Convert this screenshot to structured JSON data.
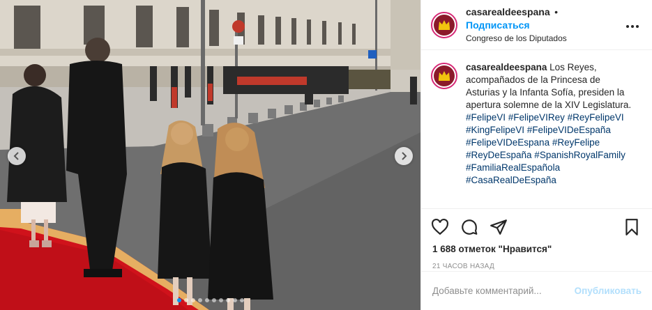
{
  "post": {
    "image_alt": "",
    "carousel": {
      "count": 10,
      "active": 0
    }
  },
  "header": {
    "username": "casarealdeespana",
    "separator": "•",
    "follow_label": "Подписаться",
    "location": "Congreso de los Diputados",
    "more_icon": "more-horizontal-icon"
  },
  "caption": {
    "username": "casarealdeespana",
    "text": "Los Reyes, acompañados de la Princesa de Asturias y la Infanta Sofía, presiden la apertura solemne de la XIV Legislatura.",
    "hashtags": [
      "#FelipeVI #FelipeVIRey #ReyFelipeVI",
      "#KingFelipeVI #FelipeVIDeEspaña",
      "#FelipeVIDeEspana #ReyFelipe",
      "#ReyDeEspaña #SpanishRoyalFamily",
      "#FamiliaRealEspañola",
      "#CasaRealDeEspaña"
    ]
  },
  "actions": {
    "like_icon": "heart-icon",
    "comment_icon": "comment-icon",
    "share_icon": "share-icon",
    "save_icon": "bookmark-icon"
  },
  "likes_text": "1 688 отметок \"Нравится\"",
  "time_ago": "21 часов назад",
  "comment_box": {
    "placeholder": "Добавьте комментарий...",
    "publish_label": "Опубликовать"
  },
  "colors": {
    "accent": "#0095f6",
    "carpet": "#d0121b",
    "brand_avatar": "#8b1a2b"
  }
}
